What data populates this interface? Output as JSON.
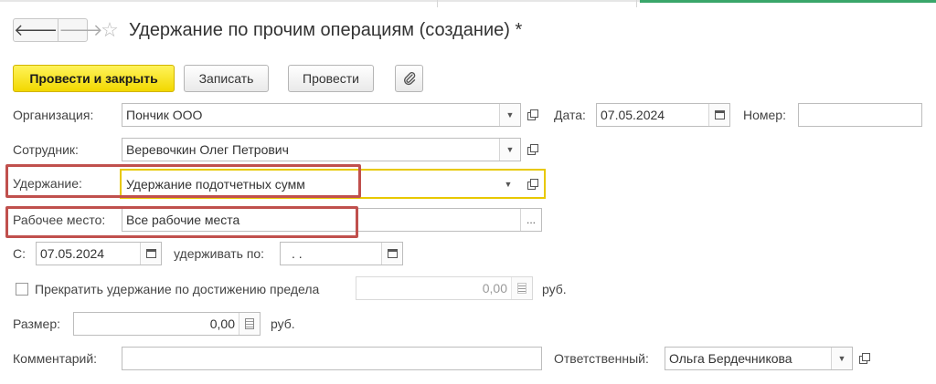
{
  "header": {
    "back_icon": "arrow-left-icon",
    "forward_icon": "arrow-right-icon",
    "favorite_icon": "star-icon",
    "title": "Удержание по прочим операциям (создание) *"
  },
  "toolbar": {
    "post_close_label": "Провести и закрыть",
    "save_label": "Записать",
    "post_label": "Провести",
    "attach_icon": "paperclip-icon"
  },
  "form": {
    "organization": {
      "label": "Организация:",
      "value": "Пончик ООО"
    },
    "date": {
      "label": "Дата:",
      "value": "07.05.2024"
    },
    "number": {
      "label": "Номер:",
      "value": ""
    },
    "employee": {
      "label": "Сотрудник:",
      "value": "Веревочкин Олег Петрович"
    },
    "deduction": {
      "label": "Удержание:",
      "value": "Удержание подотчетных сумм"
    },
    "workplace": {
      "label": "Рабочее место:",
      "value": "Все рабочие места",
      "button": "..."
    },
    "from": {
      "label": "С:",
      "value": "07.05.2024"
    },
    "until": {
      "label": "удерживать по:",
      "value": " .  ."
    },
    "stop_limit": {
      "label": "Прекратить удержание по достижению предела",
      "checked": false,
      "value": "0,00",
      "unit": "руб."
    },
    "size": {
      "label": "Размер:",
      "value": "0,00",
      "unit": "руб."
    },
    "comment": {
      "label": "Комментарий:",
      "value": ""
    },
    "responsible": {
      "label": "Ответственный:",
      "value": "Ольга Бердечникова"
    }
  },
  "colors": {
    "primary_button": "#f5dc00",
    "highlight_frame": "#c0504d",
    "active_field_border": "#e8c800",
    "top_accent": "#3aa66a"
  }
}
